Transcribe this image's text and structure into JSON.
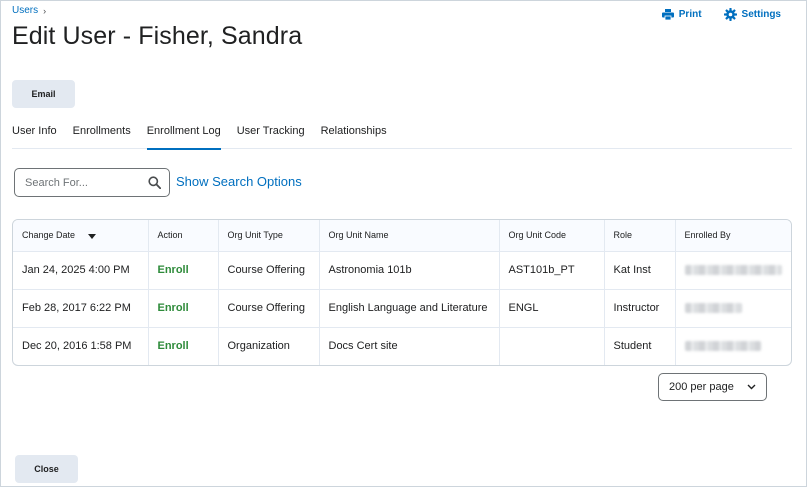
{
  "breadcrumb": {
    "link": "Users"
  },
  "page": {
    "title": "Edit User - Fisher, Sandra"
  },
  "top_actions": {
    "print_label": "Print",
    "settings_label": "Settings"
  },
  "buttons": {
    "email_label": "Email",
    "close_label": "Close"
  },
  "tabs": [
    {
      "label": "User Info",
      "active": false
    },
    {
      "label": "Enrollments",
      "active": false
    },
    {
      "label": "Enrollment Log",
      "active": true
    },
    {
      "label": "User Tracking",
      "active": false
    },
    {
      "label": "Relationships",
      "active": false
    }
  ],
  "search": {
    "placeholder": "Search For...",
    "value": "",
    "options_link": "Show Search Options"
  },
  "table": {
    "sorted_column": "Change Date",
    "sort_direction": "descending",
    "columns": [
      "Change Date",
      "Action",
      "Org Unit Type",
      "Org Unit Name",
      "Org Unit Code",
      "Role",
      "Enrolled By"
    ],
    "rows": [
      {
        "change_date": "Jan 24, 2025 4:00 PM",
        "action": "Enroll",
        "org_unit_type": "Course Offering",
        "org_unit_name": "Astronomia 101b",
        "org_unit_code": "AST101b_PT",
        "role": "Kat Inst",
        "enrolled_by": ""
      },
      {
        "change_date": "Feb 28, 2017 6:22 PM",
        "action": "Enroll",
        "org_unit_type": "Course Offering",
        "org_unit_name": "English Language and Literature",
        "org_unit_code": "ENGL",
        "role": "Instructor",
        "enrolled_by": ""
      },
      {
        "change_date": "Dec 20, 2016 1:58 PM",
        "action": "Enroll",
        "org_unit_type": "Organization",
        "org_unit_name": "Docs Cert site",
        "org_unit_code": "",
        "role": "Student",
        "enrolled_by": ""
      }
    ]
  },
  "pagination": {
    "per_page_label": "200 per page"
  },
  "colors": {
    "link": "#006fbf",
    "enroll_action": "#2e8b3a",
    "button_bg": "#e3e9f1",
    "border": "#cdd5dc"
  },
  "icons": {
    "print": "printer-icon",
    "settings": "gear-icon",
    "search": "search-icon",
    "sort": "sort-down-icon",
    "select": "chevron-down-icon",
    "breadcrumb": "chevron-right-icon"
  }
}
